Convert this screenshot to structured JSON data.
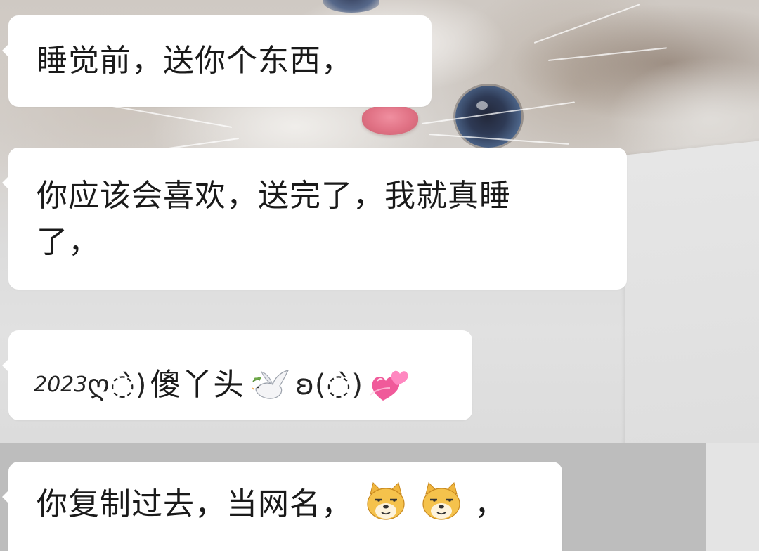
{
  "chat": {
    "messages": [
      {
        "text": "睡觉前，送你个东西，"
      },
      {
        "line1": "你应该会喜欢，送完了，我就真睡",
        "line2": "了，"
      },
      {
        "nickname": {
          "year": "2023",
          "deco1": "ღ◌̀)",
          "name": "傻丫头",
          "dove_icon": "dove-emoji",
          "deco2": "ʚ(◌̀)",
          "hearts_icon": "two-hearts-emoji"
        }
      },
      {
        "text": "你复制过去，当网名，",
        "trailing": "，",
        "emoji_icon": "doge-emoji"
      }
    ]
  },
  "colors": {
    "bubble": "#ffffff",
    "text": "#1a1a1a",
    "nose": "#e07184",
    "eye": "#4b6387",
    "heart": "#f05a9a"
  }
}
